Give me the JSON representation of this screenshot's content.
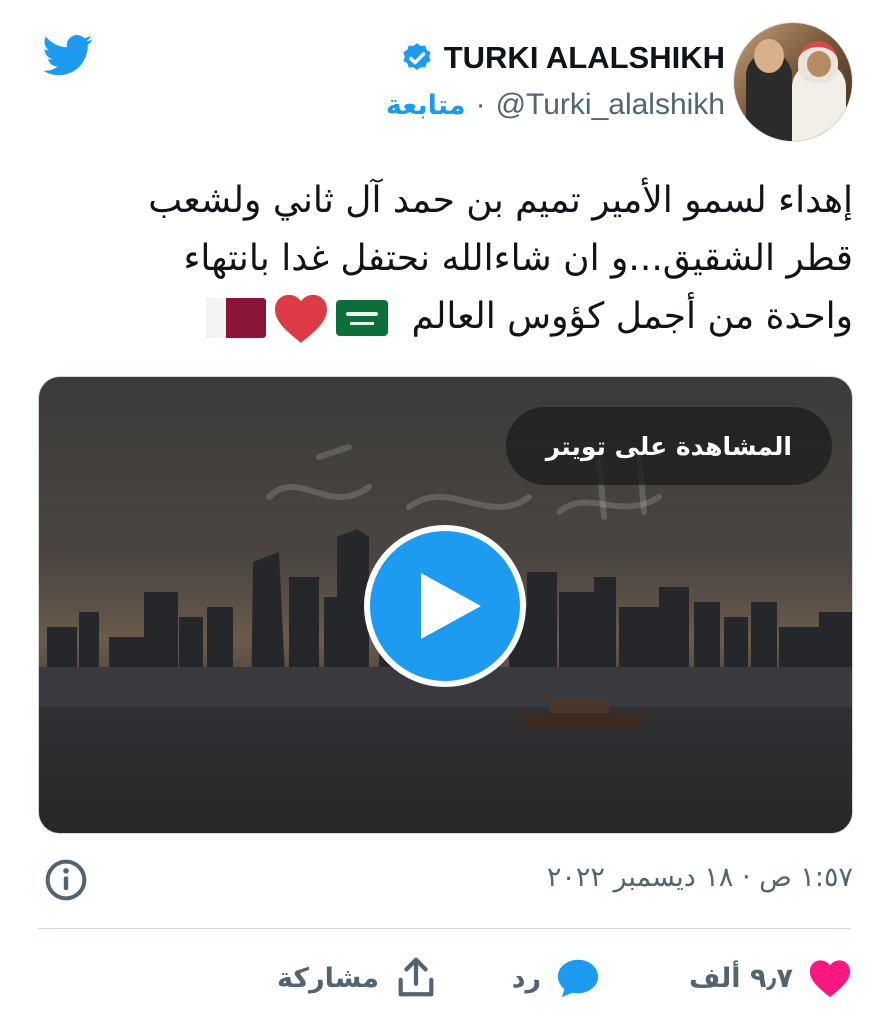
{
  "header": {
    "display_name": "TURKI ALALSHIKH",
    "handle": "@Turki_alalshikh",
    "separator": "·",
    "follow_label": "متابعة",
    "icons": [
      "twitter-bird-icon",
      "verified-badge-icon",
      "avatar"
    ]
  },
  "tweet": {
    "lines": [
      "إهداء لسمو الأمير تميم بن حمد آل ثاني ولشعب",
      "قطر الشقيق...و ان شاءالله نحتفل غدا بانتهاء",
      "واحدة من أجمل كؤوس العالم"
    ],
    "emojis": [
      "saudi-flag-emoji",
      "red-heart-emoji",
      "qatar-flag-emoji"
    ]
  },
  "media": {
    "watch_label": "المشاهدة على تويتر",
    "type": "video"
  },
  "meta": {
    "timestamp": "١:٥٧ ص · ١٨ ديسمبر ٢٠٢٢"
  },
  "actions": {
    "like_count": "٩٫٧ ألف",
    "reply_label": "رد",
    "share_label": "مشاركة"
  },
  "colors": {
    "accent": "#1d9bf0",
    "like": "#f91880",
    "text": "#0f1419",
    "muted": "#536471"
  }
}
